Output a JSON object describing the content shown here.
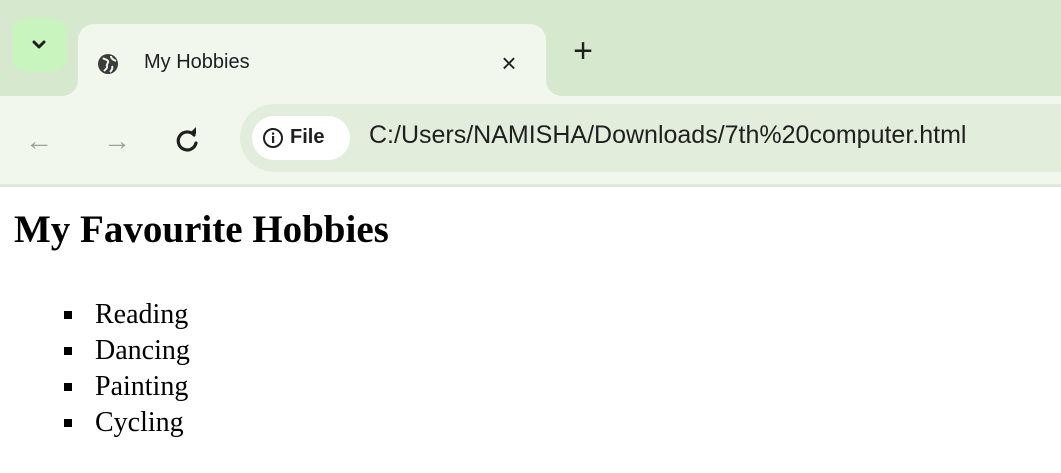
{
  "browser": {
    "tab": {
      "title": "My Hobbies",
      "close_glyph": "×",
      "favicon": "globe-icon"
    },
    "new_tab_glyph": "+",
    "tab_search_icon": "chevron-down-icon",
    "nav": {
      "back_glyph": "←",
      "forward_glyph": "→",
      "reload_glyph": "C"
    },
    "site_info": {
      "label": "File",
      "icon": "info-icon"
    },
    "url": "C:/Users/NAMISHA/Downloads/7th%20computer.html",
    "colors": {
      "tabbar": "#d6e8cd",
      "active_tab": "#f1f7ed",
      "tab_search_button": "#c7f5bd",
      "omnibox": "#e3eddc"
    }
  },
  "page": {
    "heading": "My Favourite Hobbies",
    "hobbies": [
      "Reading",
      "Dancing",
      "Painting",
      "Cycling"
    ]
  }
}
